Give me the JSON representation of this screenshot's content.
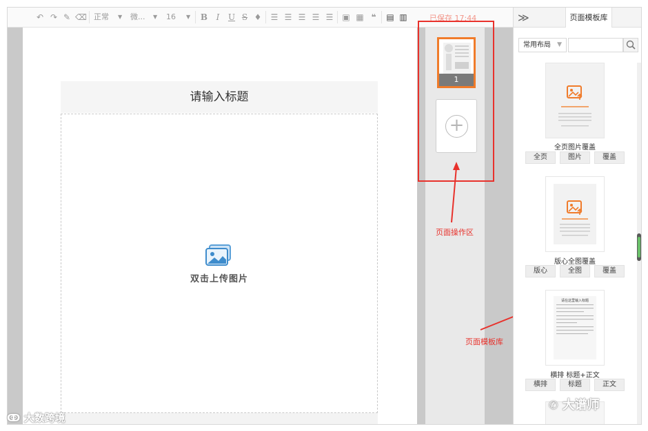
{
  "toolbar": {
    "undo_icon": "undo-icon",
    "redo_icon": "redo-icon",
    "format_painter_icon": "format-painter-icon",
    "eraser_icon": "eraser-icon",
    "paragraph_style": "正常",
    "font_family": "微...",
    "font_size": "16",
    "bold": "B",
    "italic": "I",
    "underline": "U",
    "strikethrough": "S",
    "save_status": "已保存 17:44"
  },
  "editor": {
    "title_placeholder": "请输入标题",
    "upload_hint": "双击上传图片"
  },
  "page_strip": {
    "page_number": "1",
    "add_page_symbol": "+"
  },
  "annotations": {
    "page_operation_area": "页面操作区",
    "page_template_library": "页面模板库"
  },
  "right_panel": {
    "collapse_symbol": "≫",
    "tab_label": "页面模板库",
    "layout_filter": "常用布局",
    "search_placeholder": "",
    "templates": [
      {
        "name": "全页图片覆盖",
        "buttons": [
          "全页",
          "图片",
          "覆盖"
        ]
      },
      {
        "name": "版心全图覆盖",
        "buttons": [
          "版心",
          "全图",
          "覆盖"
        ]
      },
      {
        "name": "横排 标题+正文",
        "buttons": [
          "横排",
          "标题",
          "正文"
        ]
      }
    ],
    "template_2_card_title": "请在这里输入标题"
  },
  "watermarks": {
    "left": "大数跨境",
    "right": "大谱师"
  },
  "colors": {
    "accent_orange": "#f07b2a",
    "annotation_red": "#e8312b",
    "save_status": "#f29488"
  }
}
